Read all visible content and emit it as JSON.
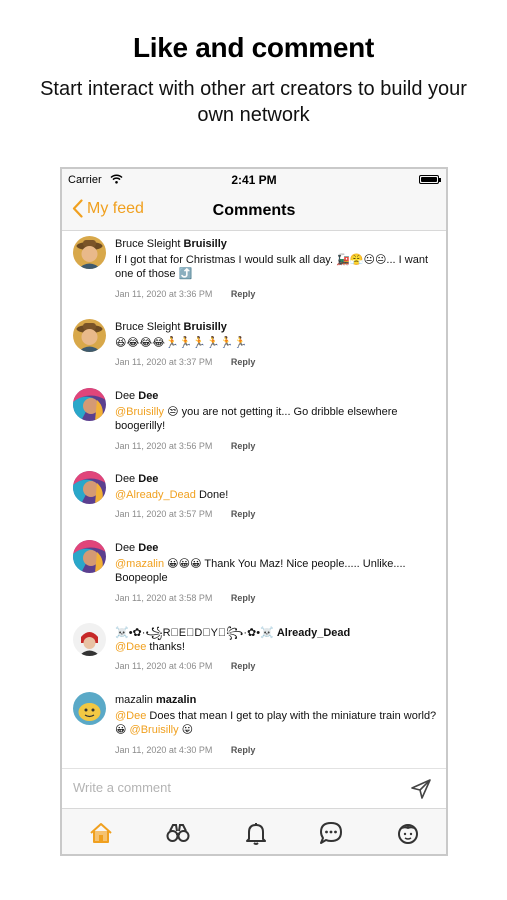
{
  "promo": {
    "title": "Like and comment",
    "subtitle": "Start interact with other art creators to build your own network"
  },
  "status_bar": {
    "carrier": "Carrier",
    "time": "2:41 PM"
  },
  "nav": {
    "back_label": "My feed",
    "title": "Comments"
  },
  "comments": [
    {
      "name": "Bruce Sleight",
      "username": "Bruisilly",
      "text": "If I got that for Christmas I would sulk all day. 🚂😤😐😐... I want one of those ⤴️",
      "date": "Jan 11, 2020 at 3:36 PM",
      "reply": "Reply"
    },
    {
      "name": "Bruce Sleight",
      "username": "Bruisilly",
      "text": "😆😂😂😂🏃🏃🏃🏃🏃🏃",
      "date": "Jan 11, 2020 at 3:37 PM",
      "reply": "Reply"
    },
    {
      "name": "Dee",
      "username": "Dee",
      "mention": "@Bruisilly",
      "text": "😒 you are not getting it... Go dribble elsewhere boogerilly!",
      "date": "Jan 11, 2020 at 3:56 PM",
      "reply": "Reply"
    },
    {
      "name": "Dee",
      "username": "Dee",
      "mention": "@Already_Dead",
      "text": "Done!",
      "date": "Jan 11, 2020 at 3:57 PM",
      "reply": "Reply"
    },
    {
      "name": "Dee",
      "username": "Dee",
      "mention": "@mazalin",
      "text": "😀😀😀 Thank You Maz! Nice people..... Unlike.... Boopeople",
      "date": "Jan 11, 2020 at 3:58 PM",
      "reply": "Reply"
    },
    {
      "name": "☠️•✿·꧁R⃟E⃟D⃟Y⃟꧂·✿•☠️",
      "username": "Already_Dead",
      "mention": "@Dee",
      "text": "thanks!",
      "date": "Jan 11, 2020 at 4:06 PM",
      "reply": "Reply"
    },
    {
      "name": "mazalin",
      "username": "mazalin",
      "mention": "@Dee",
      "text": "Does that mean I get to play with the miniature train world? 😀",
      "mention2": "@Bruisilly",
      "text2": "😛",
      "date": "Jan 11, 2020 at 4:30 PM",
      "reply": "Reply"
    }
  ],
  "composer": {
    "placeholder": "Write a comment"
  },
  "tabs": [
    "home-icon",
    "binoculars-icon",
    "bell-icon",
    "chat-icon",
    "profile-icon"
  ],
  "colors": {
    "accent": "#f0a01f",
    "text": "#111111",
    "meta": "#8b8b8b",
    "bar": "#f7f7f7"
  }
}
